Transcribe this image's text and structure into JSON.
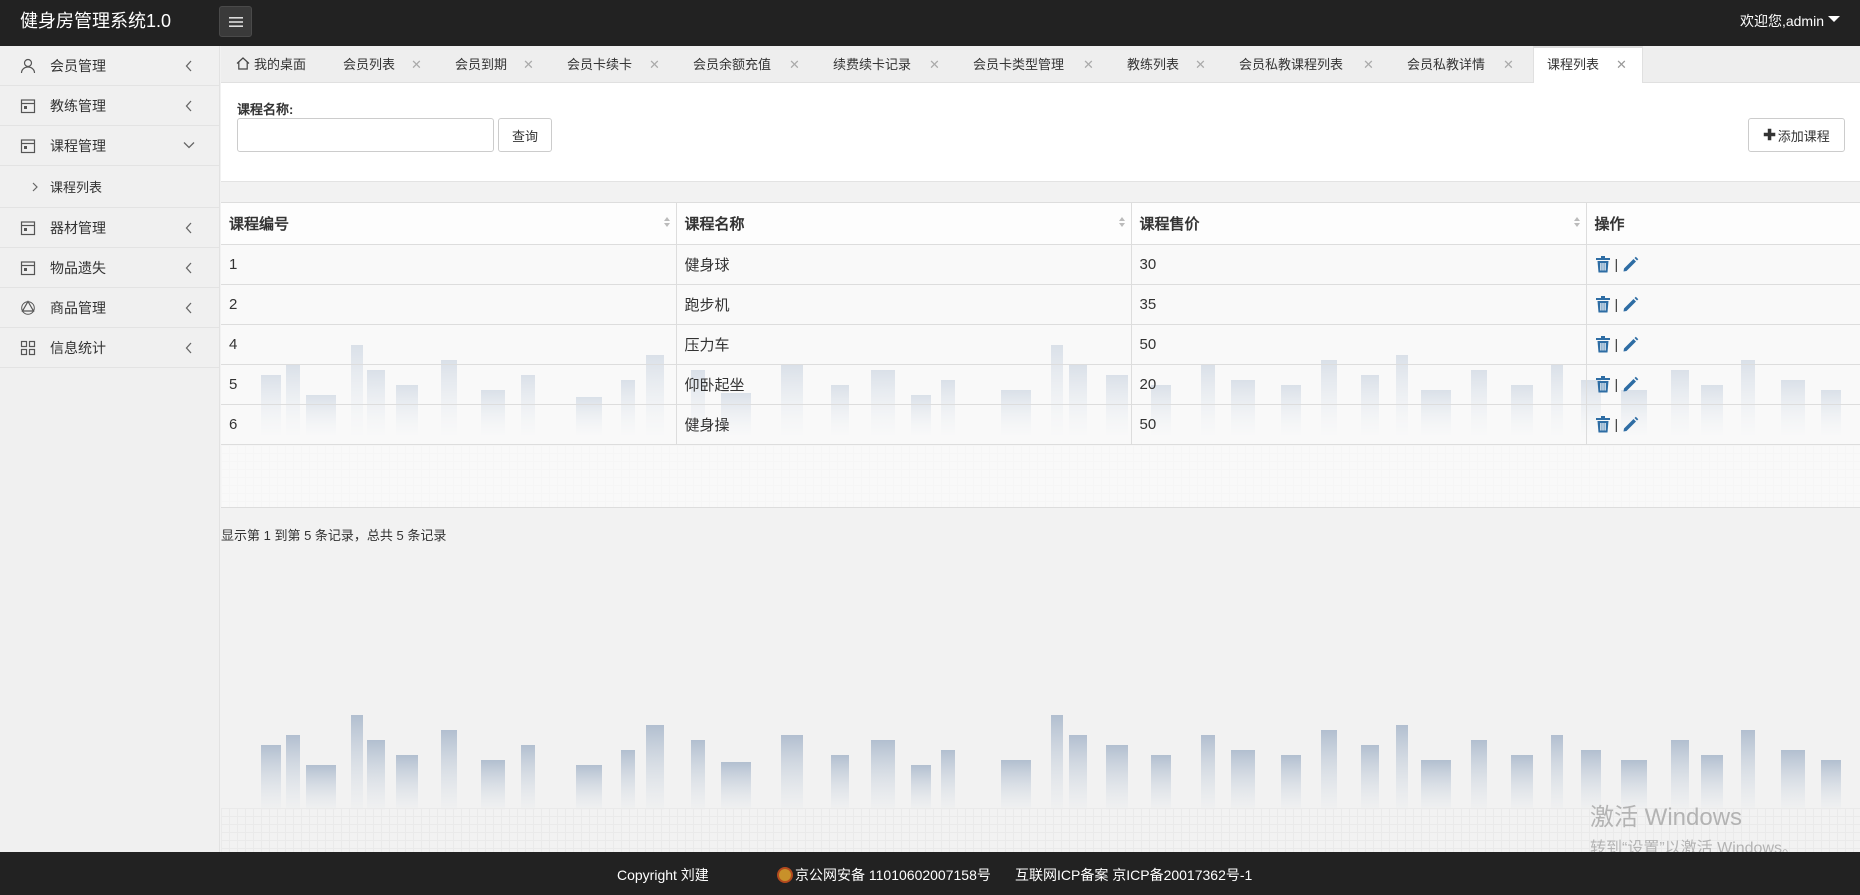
{
  "app": {
    "title": "健身房管理系统1.0",
    "welcome": "欢迎您,admin"
  },
  "sidebar": {
    "items": [
      {
        "label": "会员管理",
        "icon": "user-icon"
      },
      {
        "label": "教练管理",
        "icon": "calendar-icon"
      },
      {
        "label": "课程管理",
        "icon": "calendar-icon",
        "expanded": true,
        "children": [
          {
            "label": "课程列表"
          }
        ]
      },
      {
        "label": "器材管理",
        "icon": "calendar-icon"
      },
      {
        "label": "物品遗失",
        "icon": "calendar-icon"
      },
      {
        "label": "商品管理",
        "icon": "recycle-icon"
      },
      {
        "label": "信息统计",
        "icon": "grid-icon"
      }
    ]
  },
  "tabs": [
    {
      "label": "我的桌面",
      "icon": "home-icon",
      "closable": false
    },
    {
      "label": "会员列表",
      "closable": true
    },
    {
      "label": "会员到期",
      "closable": true
    },
    {
      "label": "会员卡续卡",
      "closable": true
    },
    {
      "label": "会员余额充值",
      "closable": true
    },
    {
      "label": "续费续卡记录",
      "closable": true
    },
    {
      "label": "会员卡类型管理",
      "closable": true
    },
    {
      "label": "教练列表",
      "closable": true
    },
    {
      "label": "会员私教课程列表",
      "closable": true
    },
    {
      "label": "会员私教详情",
      "closable": true
    },
    {
      "label": "课程列表",
      "closable": true,
      "active": true
    }
  ],
  "search": {
    "label": "课程名称:",
    "value": "",
    "query_button": "查询",
    "add_button": "添加课程"
  },
  "table": {
    "columns": [
      "课程编号",
      "课程名称",
      "课程售价",
      "操作"
    ],
    "rows": [
      {
        "id": "1",
        "name": "健身球",
        "price": "30"
      },
      {
        "id": "2",
        "name": "跑步机",
        "price": "35"
      },
      {
        "id": "4",
        "name": "压力车",
        "price": "50"
      },
      {
        "id": "5",
        "name": "仰卧起坐",
        "price": "20"
      },
      {
        "id": "6",
        "name": "健身操",
        "price": "50"
      }
    ],
    "op_separator": "|"
  },
  "pager": {
    "info": "显示第 1 到第 5 条记录，总共 5 条记录"
  },
  "activation": {
    "title": "激活 Windows",
    "subtitle": "转到“设置”以激活 Windows。"
  },
  "footer": {
    "copyright": "Copyright 刘建",
    "police": "京公网安备 11010602007158号",
    "icp": "互联网ICP备案 京ICP备20017362号-1"
  },
  "colors": {
    "header_bg": "#222222",
    "icon_blue": "#2e6da4",
    "sidebar_bg": "#f0f0f0"
  }
}
